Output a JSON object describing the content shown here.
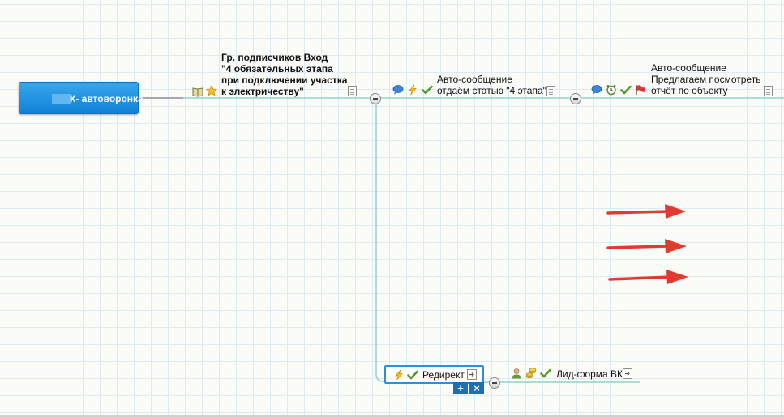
{
  "root": {
    "label": "К- автоворонка"
  },
  "nodes": {
    "subscribers": {
      "line1": "Гр. подписчиков Вход",
      "line2": "\"4 обязательных этапа",
      "line3": "при подключении участка",
      "line4": "к электричеству\"",
      "icons": [
        "book-icon",
        "star-icon",
        "note-icon"
      ]
    },
    "message1": {
      "line1": "Авто-сообщение",
      "line2": "отдаём статью \"4 этапа\"",
      "icons": [
        "speech-bubble-icon",
        "lightning-icon",
        "checkmark-icon",
        "note-icon"
      ]
    },
    "message2": {
      "line1": "Авто-сообщение",
      "line2": "Предлагаем посмотреть",
      "line3": "отчёт по объекту",
      "icons": [
        "speech-bubble-icon",
        "alarm-clock-icon",
        "checkmark-icon",
        "flag-icon",
        "note-icon"
      ]
    },
    "redirect": {
      "label": "Редирект",
      "icons": [
        "lightning-icon",
        "checkmark-icon",
        "link-icon"
      ],
      "add_label": "+",
      "delete_label": "×"
    },
    "leadform": {
      "label": "Лид-форма ВК",
      "icons": [
        "user-icon",
        "coins-icon",
        "checkmark-icon",
        "link-icon"
      ]
    }
  },
  "colors": {
    "root_gradient_top": "#36a7ee",
    "root_gradient_bottom": "#1180d6",
    "connector": "#8fd3c8",
    "grid": "#dde9f3",
    "arrow": "#e23a2e",
    "selection": "#2d8fd8"
  },
  "annotations": {
    "arrows": [
      "red-arrow",
      "red-arrow",
      "red-arrow"
    ]
  }
}
